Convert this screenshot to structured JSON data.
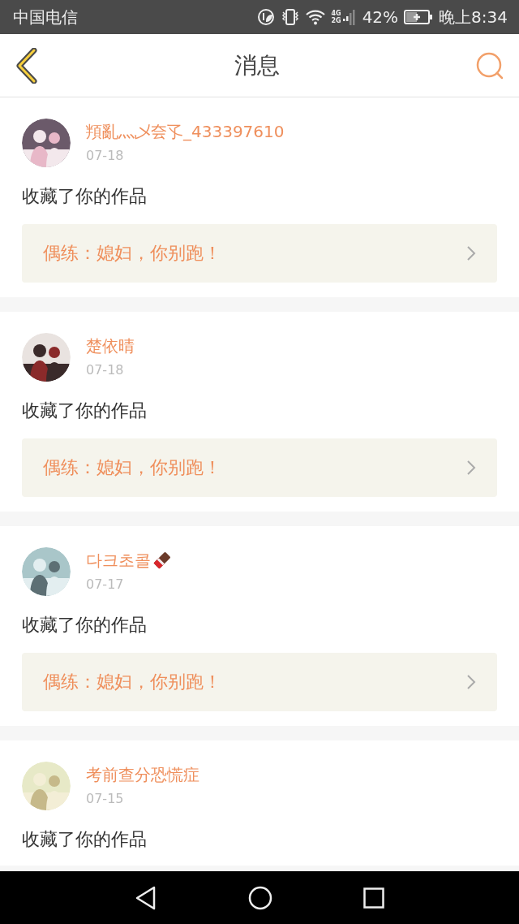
{
  "status_bar": {
    "carrier": "中国电信",
    "network_top": "4G",
    "network_bottom": "2G",
    "battery_percent": "42%",
    "time": "晚上8:34"
  },
  "header": {
    "title": "消息"
  },
  "messages": [
    {
      "username": "頖亂灬乄夽孓_433397610",
      "emoji": false,
      "date": "07-18",
      "action": "收藏了你的作品",
      "work": "偶练：媳妇，你别跑！"
    },
    {
      "username": "楚依晴",
      "emoji": false,
      "date": "07-18",
      "action": "收藏了你的作品",
      "work": "偶练：媳妇，你别跑！"
    },
    {
      "username": "다크초콜",
      "emoji": true,
      "date": "07-17",
      "action": "收藏了你的作品",
      "work": "偶练：媳妇，你别跑！"
    },
    {
      "username": "考前查分恐慌症",
      "emoji": false,
      "date": "07-15",
      "action": "收藏了你的作品"
    }
  ]
}
